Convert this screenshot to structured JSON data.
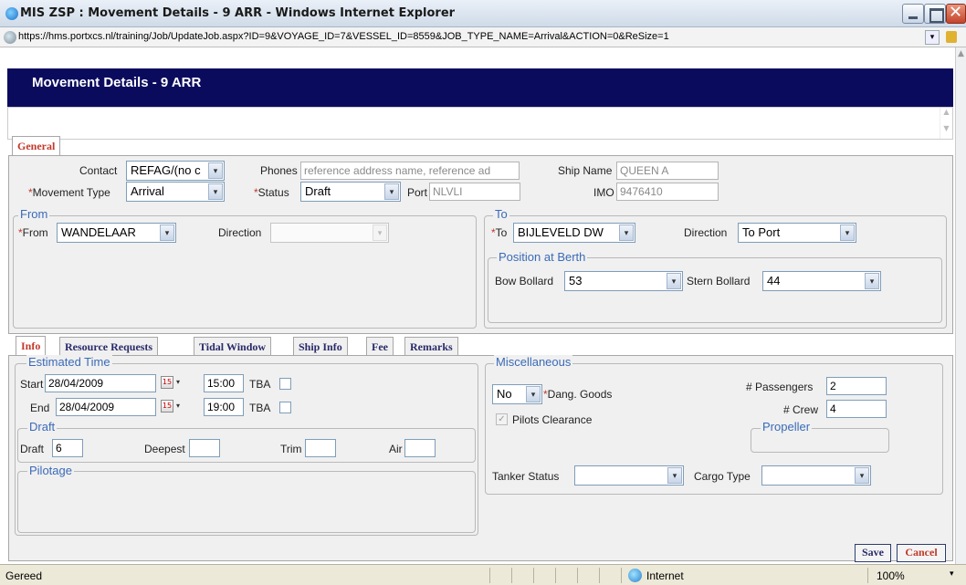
{
  "window": {
    "title": "MIS ZSP : Movement Details - 9 ARR - Windows Internet Explorer",
    "url": "https://hms.portxcs.nl/training/Job/UpdateJob.aspx?ID=9&VOYAGE_ID=7&VESSEL_ID=8559&JOB_TYPE_NAME=Arrival&ACTION=0&ReSize=1"
  },
  "header": {
    "title": "Movement Details - 9 ARR"
  },
  "top_tabs": [
    {
      "label": "General",
      "active": true
    }
  ],
  "general": {
    "contact_label": "Contact",
    "contact_value": "REFAG/(no c",
    "phones_label": "Phones",
    "phones_value": "reference address name, reference ad",
    "ship_name_label": "Ship Name",
    "ship_name_value": "QUEEN A",
    "movement_type_label": "Movement Type",
    "movement_type_value": "Arrival",
    "status_label": "Status",
    "status_value": "Draft",
    "port_label": "Port",
    "port_value": "NLVLI",
    "imo_label": "IMO",
    "imo_value": "9476410",
    "required_mark": "*"
  },
  "from_section": {
    "legend": "From",
    "from_label": "From",
    "from_value": "WANDELAAR",
    "direction_label": "Direction",
    "direction_value": ""
  },
  "to_section": {
    "legend": "To",
    "to_label": "To",
    "to_value": "BIJLEVELD DW",
    "direction_label": "Direction",
    "direction_value": "To Port",
    "berth_legend": "Position at Berth",
    "bow_label": "Bow Bollard",
    "bow_value": "53",
    "stern_label": "Stern Bollard",
    "stern_value": "44"
  },
  "sub_tabs": [
    {
      "label": "Info",
      "active": true
    },
    {
      "label": "Resource Requests",
      "active": false
    },
    {
      "label": "Tidal Window",
      "active": false
    },
    {
      "label": "Ship Info",
      "active": false
    },
    {
      "label": "Fee",
      "active": false
    },
    {
      "label": "Remarks",
      "active": false
    }
  ],
  "info": {
    "estimated_legend": "Estimated Time",
    "start_label": "Start",
    "start_date": "28/04/2009",
    "start_time": "15:00",
    "end_label": "End",
    "end_date": "28/04/2009",
    "end_time": "19:00",
    "tba_label": "TBA",
    "draft_legend": "Draft",
    "draft_label": "Draft",
    "draft_value": "6",
    "deepest_label": "Deepest",
    "deepest_value": "",
    "trim_label": "Trim",
    "trim_value": "",
    "air_label": "Air",
    "air_value": "",
    "pilotage_legend": "Pilotage"
  },
  "misc": {
    "legend": "Miscellaneous",
    "dang_goods_value": "No",
    "dang_goods_label": "Dang. Goods",
    "passengers_label": "# Passengers",
    "passengers_value": "2",
    "crew_label": "# Crew",
    "crew_value": "4",
    "pilots_clearance_label": "Pilots Clearance",
    "pilots_clearance_checked": true,
    "propeller_legend": "Propeller",
    "tanker_status_label": "Tanker Status",
    "tanker_status_value": "",
    "cargo_type_label": "Cargo Type",
    "cargo_type_value": ""
  },
  "actions": {
    "save_label": "Save",
    "cancel_label": "Cancel"
  },
  "statusbar": {
    "text": "Gereed",
    "zone": "Internet",
    "zoom": "100%"
  },
  "icons": {
    "arrow": "▾",
    "check": "✓",
    "calendar": "15"
  }
}
